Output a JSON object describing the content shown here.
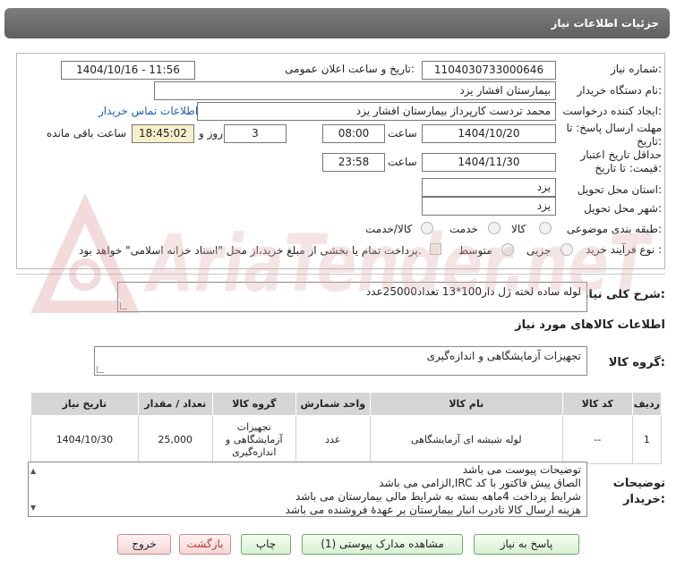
{
  "window": {
    "title": "جزئیات اطلاعات نیاز"
  },
  "form": {
    "need_number_label": "شماره نیاز:",
    "need_number": "1104030733000646",
    "announce_label": "تاریخ و ساعت اعلان عمومی:",
    "announce_value": "1404/10/16 - 11:56",
    "buyer_org_label": "نام دستگاه خریدار:",
    "buyer_org": "بیمارستان افشار یزد",
    "creator_label": "ایجاد کننده درخواست:",
    "creator": "محمد تردست کارپرداز بیمارستان افشار یزد",
    "contact_link": "اطلاعات تماس خریدار",
    "deadline_label": "مهلت ارسال پاسخ: تا تاریخ:",
    "deadline_date": "1404/10/20",
    "time_word": "ساعت",
    "deadline_time": "08:00",
    "days_value": "3",
    "days_and": "روز و",
    "remaining_time": "18:45:02",
    "remaining_label": "ساعت باقی مانده",
    "validity_label": "حداقل تاریخ اعتبار قیمت: تا تاریخ:",
    "validity_date": "1404/11/30",
    "validity_time": "23:58",
    "province_label": "استان محل تحویل:",
    "province": "یزد",
    "city_label": "شهر محل تحویل:",
    "city": "یزد",
    "category_label": "طبقه بندی موضوعی:",
    "category_options": [
      "کالا",
      "خدمت",
      "کالا/خدمت"
    ],
    "process_label": "نوع فرآیند خرید :",
    "process_options": [
      "جزیی",
      "متوسط"
    ],
    "payment_text": "پرداخت تمام یا بخشی از مبلغ خرید،از محل \"اسناد خزانه اسلامی\" خواهد بود."
  },
  "summary": {
    "label": "شرح کلی نیاز:",
    "value": "لوله ساده لخته ژل دار100*13 تعداد25000عدد"
  },
  "goods": {
    "section_title": "اطلاعات کالاهای مورد نیاز",
    "group_label": "گروه کالا:",
    "group_value": "تجهیزات آزمایشگاهی و اندازه‌گیری"
  },
  "table": {
    "headers": [
      "ردیف",
      "کد کالا",
      "نام کالا",
      "واحد شمارش",
      "گروه کالا",
      "تعداد / مقدار",
      "تاریخ نیاز"
    ],
    "rows": [
      [
        "1",
        "--",
        "لوله شیشه ای آزمایشگاهی",
        "عدد",
        "تجهیزات آزمایشگاهی و اندازه‌گیری",
        "25,000",
        "1404/10/30"
      ]
    ]
  },
  "buyer_notes": {
    "label": "توضیحات خریدار:",
    "lines": [
      "توضیحات پیوست می باشد",
      "الصاق پیش فاکتور با کد  IRC,الزامی می باشد",
      "شرایط پرداخت  4ماهه بسته به شرایط مالی بیمارستان می باشد",
      "هزینه ارسال کالا تادرب انبار بیمارستان بر عهدهٔ فروشنده می باشد"
    ]
  },
  "buttons": {
    "reply": "پاسخ به نیاز",
    "attachments": "مشاهده مدارک پیوستی (1)",
    "print": "چاپ",
    "back": "بازگشت",
    "exit": "خروج"
  },
  "watermark": {
    "text": "AriaTender.neT"
  },
  "colors": {
    "titlebar": "#6e6e6e",
    "link": "#1a5fb4",
    "timer_bg": "#f7efcb",
    "button_border": "#6aa86a",
    "watermark": "#e7c3c3"
  }
}
